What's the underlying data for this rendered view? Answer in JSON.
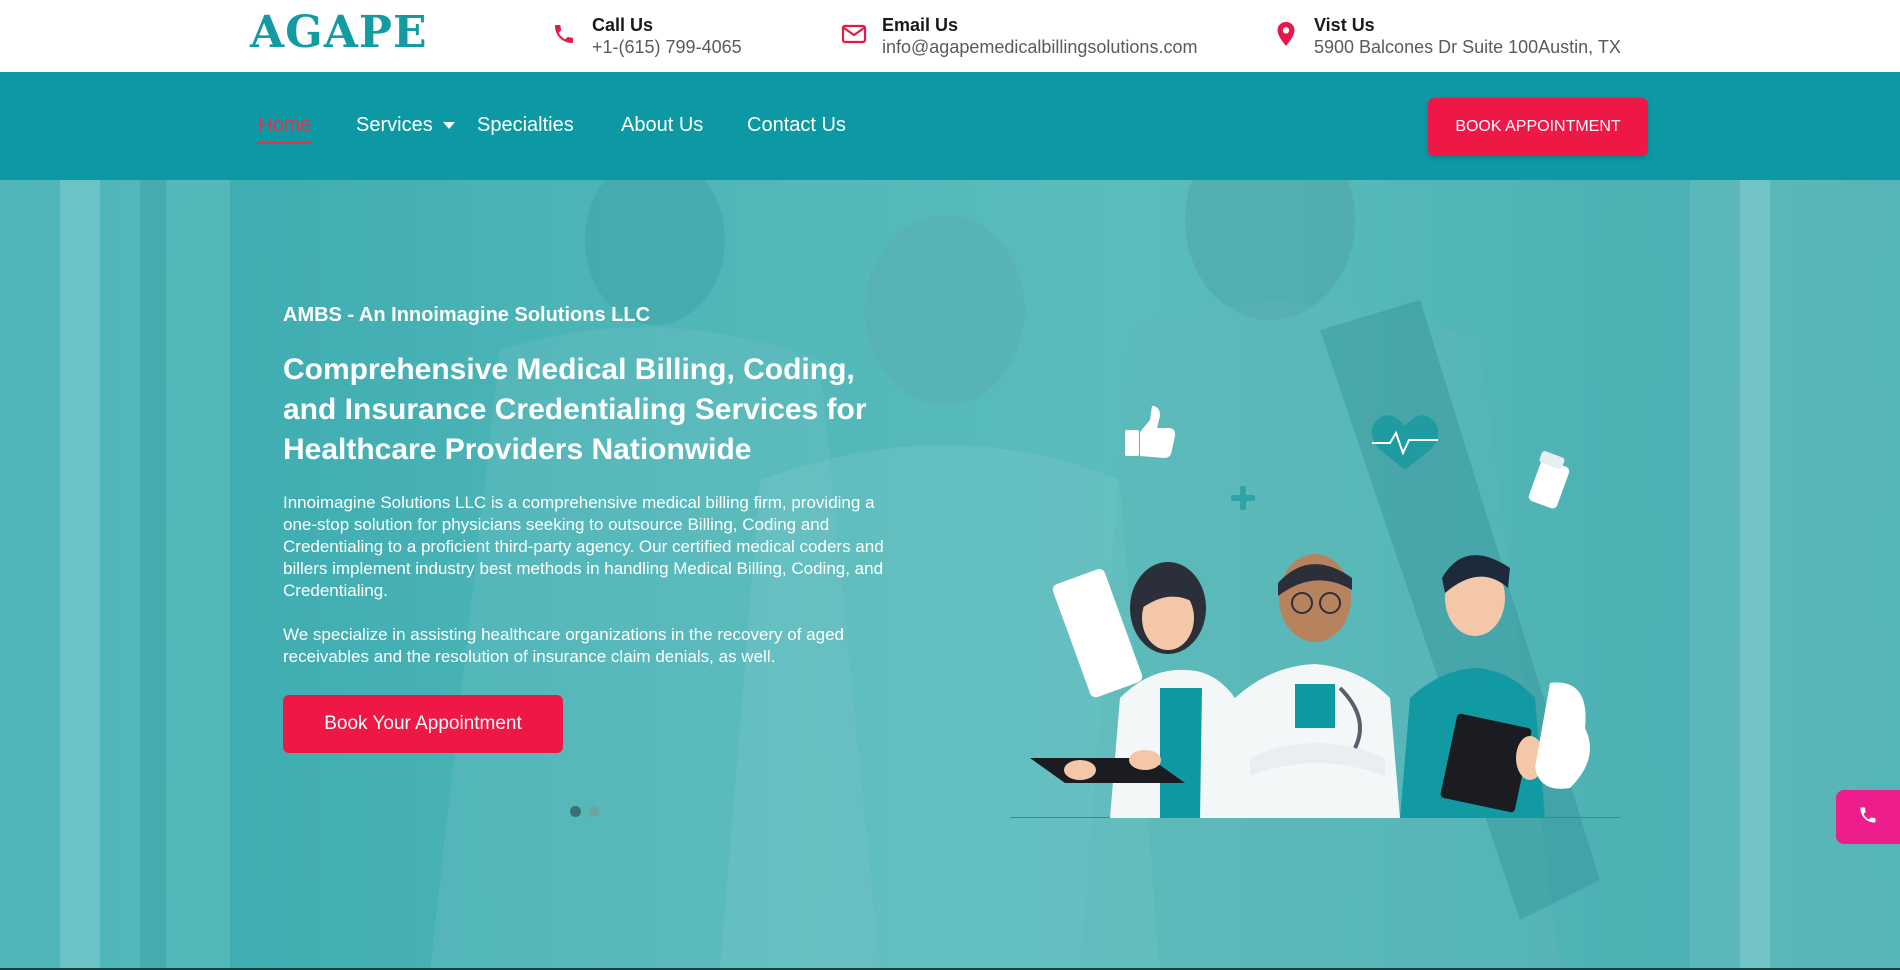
{
  "brand": {
    "logo_text": "AGAPE"
  },
  "topbar": {
    "call": {
      "title": "Call Us",
      "value": "+1-(615) 799-4065",
      "icon": "phone-icon"
    },
    "email": {
      "title": "Email Us",
      "value": "info@agapemedicalbillingsolutions.com",
      "icon": "envelope-icon"
    },
    "visit": {
      "title": "Vist Us",
      "value": "5900 Balcones Dr Suite 100Austin, TX",
      "icon": "map-pin-icon"
    }
  },
  "nav": {
    "items": [
      {
        "label": "Home",
        "active": true
      },
      {
        "label": "Services",
        "has_dropdown": true
      },
      {
        "label": "Specialties"
      },
      {
        "label": "About Us"
      },
      {
        "label": "Contact Us"
      }
    ],
    "cta_label": "BOOK APPOINTMENT"
  },
  "hero": {
    "eyebrow": "AMBS - An Innoimagine Solutions LLC",
    "headline": "Comprehensive Medical Billing, Coding, and Insurance Credentialing Services for Healthcare Providers Nationwide",
    "paragraph1": "Innoimagine Solutions LLC is a comprehensive medical billing firm, providing a one-stop solution for physicians seeking to outsource Billing, Coding and Credentialing to a proficient third-party agency. Our certified medical coders and billers implement industry best methods in handling Medical Billing, Coding, and Credentialing.",
    "paragraph2": "We specialize in assisting healthcare organizations in the recovery of aged receivables and the resolution of insurance claim denials, as well.",
    "button_label": "Book Your Appointment",
    "slides": {
      "count": 2,
      "active": 1
    }
  },
  "floating": {
    "icon": "phone-icon"
  },
  "colors": {
    "brand_teal": "#149ba2",
    "nav_bg": "#0d99a4",
    "accent_red": "#ee1745",
    "float_pink": "#ee1d8c"
  }
}
